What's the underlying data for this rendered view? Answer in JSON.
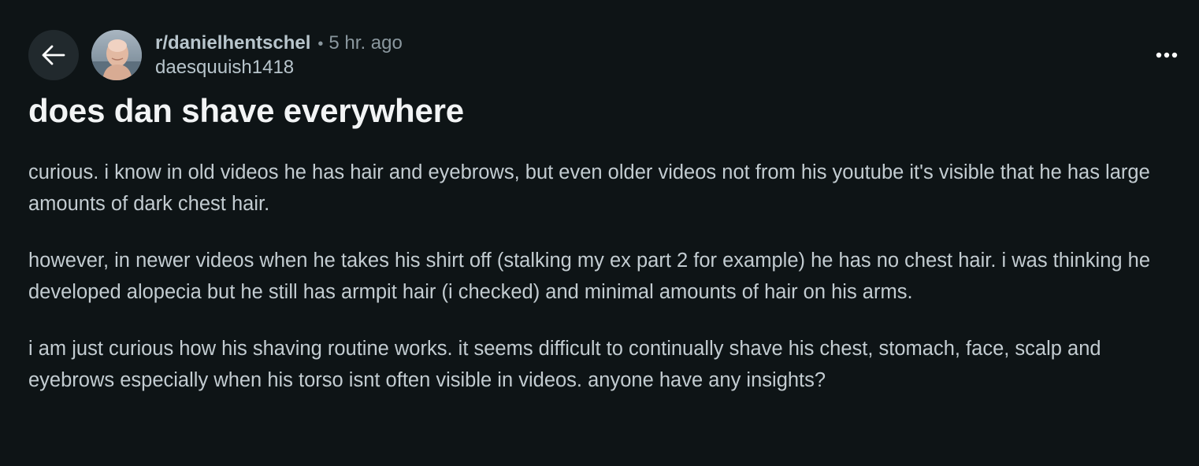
{
  "header": {
    "subreddit": "r/danielhentschel",
    "separator": "•",
    "time": "5 hr. ago",
    "author": "daesquuish1418"
  },
  "post": {
    "title": "does dan shave everywhere",
    "paragraphs": [
      "curious. i know in old videos he has hair and eyebrows, but even older videos not from his youtube it's visible that he has large amounts of dark chest hair.",
      "however, in newer videos when he takes his shirt off (stalking my ex part 2 for example) he has no chest hair. i was thinking he developed alopecia but he still has armpit hair (i checked) and minimal amounts of hair on his arms.",
      "i am just curious how his shaving routine works. it seems difficult to continually shave his chest, stomach, face, scalp and eyebrows especially when his torso isnt often visible in videos. anyone have any insights?"
    ]
  },
  "icons": {
    "back": "arrow-left-icon",
    "more": "more-horizontal-icon"
  },
  "colors": {
    "background": "#0e1416",
    "button_background": "#21292d",
    "title": "#f2f4f5",
    "body_text": "#c3ccd1",
    "meta_text": "#8a979e"
  }
}
